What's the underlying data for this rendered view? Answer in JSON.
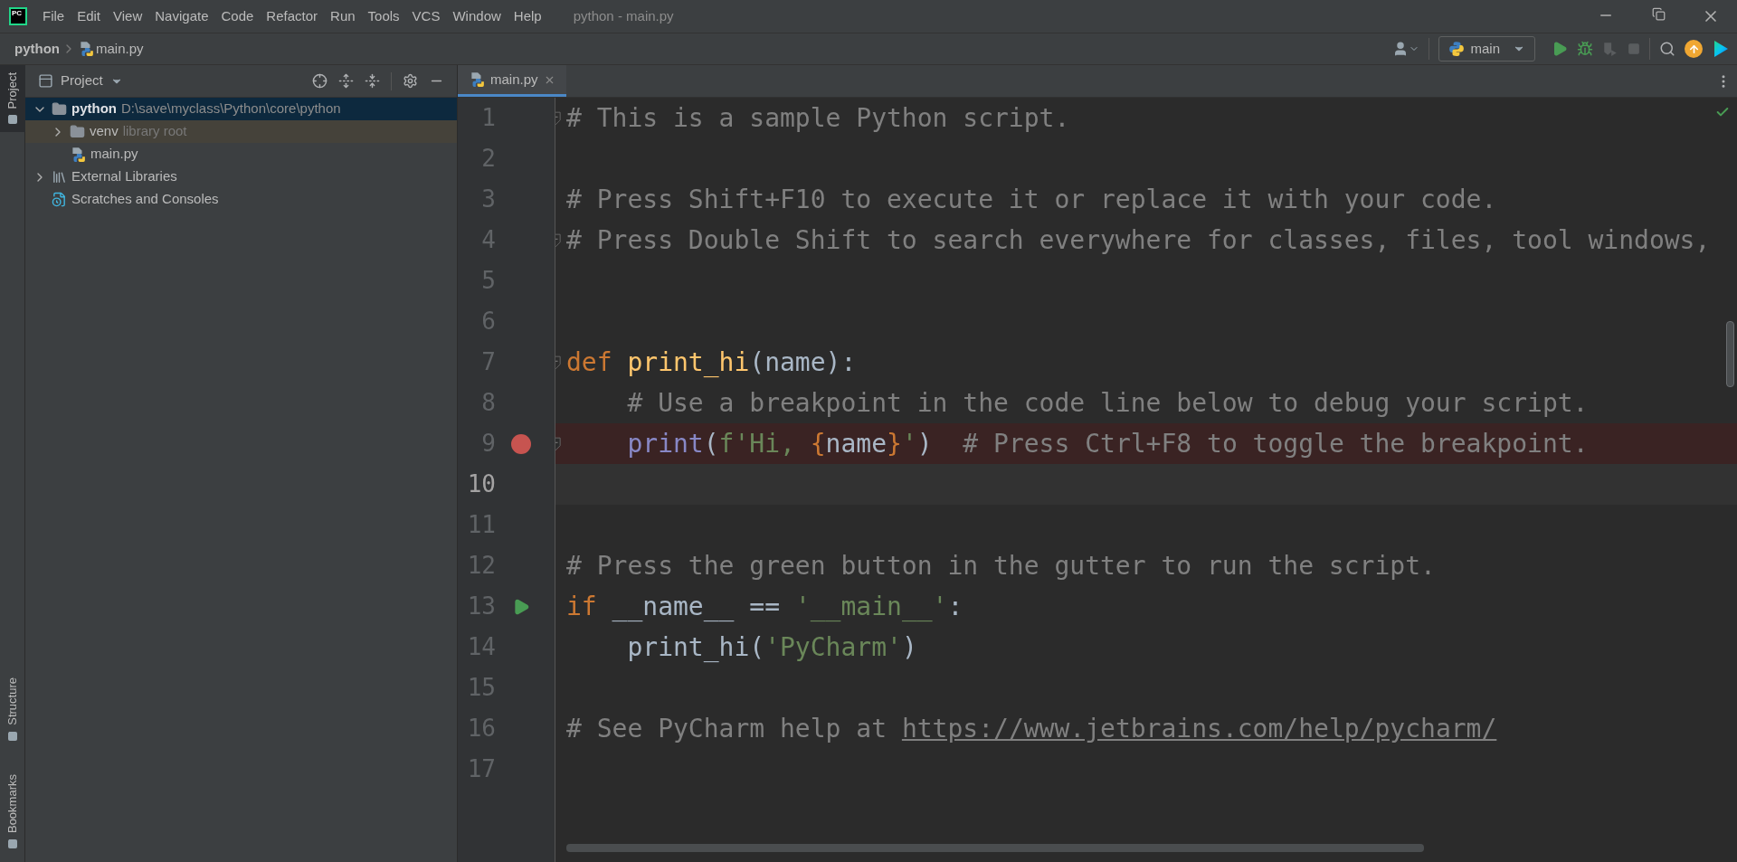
{
  "logo": "PC",
  "menu": [
    "File",
    "Edit",
    "View",
    "Navigate",
    "Code",
    "Refactor",
    "Run",
    "Tools",
    "VCS",
    "Window",
    "Help"
  ],
  "window_title": "python - main.py",
  "breadcrumbs": [
    "python",
    "main.py"
  ],
  "run_config": "main",
  "side_tabs_top": [
    {
      "label": "Project",
      "selected": true
    }
  ],
  "side_tabs_bottom": [
    {
      "label": "Structure",
      "selected": false
    },
    {
      "label": "Bookmarks",
      "selected": false
    }
  ],
  "project_panel": {
    "title": "Project",
    "tree": [
      {
        "name": "python",
        "path": "D:\\save\\myclass\\Python\\core\\python",
        "kind": "folder",
        "expanded": true,
        "selected": true,
        "children": [
          {
            "name": "venv",
            "note": "library root",
            "kind": "library_folder",
            "expanded": false,
            "selected": false
          },
          {
            "name": "main.py",
            "kind": "python_file",
            "selected": false
          }
        ]
      },
      {
        "name": "External Libraries",
        "kind": "libraries",
        "expanded": false,
        "selected": false
      },
      {
        "name": "Scratches and Consoles",
        "kind": "scratches",
        "selected": false
      }
    ]
  },
  "tabs": [
    {
      "label": "main.py",
      "selected": true
    }
  ],
  "code_lines": [
    {
      "number": "1",
      "fold": true,
      "current": false,
      "breakpoint": false,
      "run_marker": false,
      "tokens": [
        {
          "kind": "comment",
          "text": "# This is a sample Python script."
        }
      ]
    },
    {
      "number": "2",
      "fold": false,
      "current": false,
      "breakpoint": false,
      "run_marker": false
    },
    {
      "number": "3",
      "fold": false,
      "current": false,
      "breakpoint": false,
      "run_marker": false,
      "tokens": [
        {
          "kind": "comment",
          "text": "# Press Shift+F10 to execute it or replace it with your code."
        }
      ]
    },
    {
      "number": "4",
      "fold": true,
      "current": false,
      "breakpoint": false,
      "run_marker": false,
      "tokens": [
        {
          "kind": "comment",
          "text": "# Press Double Shift to search everywhere for classes, files, tool windows,"
        }
      ]
    },
    {
      "number": "5",
      "fold": false,
      "current": false,
      "breakpoint": false,
      "run_marker": false
    },
    {
      "number": "6",
      "fold": false,
      "current": false,
      "breakpoint": false,
      "run_marker": false
    },
    {
      "number": "7",
      "fold": true,
      "current": false,
      "breakpoint": false,
      "run_marker": false,
      "tokens": [
        {
          "kind": "keyword",
          "text": "def "
        },
        {
          "kind": "def_name",
          "text": "print_hi"
        },
        {
          "kind": "plain",
          "text": "(name):"
        }
      ]
    },
    {
      "number": "8",
      "fold": false,
      "current": false,
      "breakpoint": false,
      "run_marker": false,
      "tokens": [
        {
          "kind": "comment",
          "text": "    # Use a breakpoint in the code line below to debug your script."
        }
      ]
    },
    {
      "number": "9",
      "fold": true,
      "current": false,
      "breakpoint": true,
      "run_marker": false,
      "tokens": [
        {
          "kind": "builtin",
          "text": "    print"
        },
        {
          "kind": "plain",
          "text": "("
        },
        {
          "kind": "string",
          "text": "f'Hi, "
        },
        {
          "kind": "brace",
          "text": "{"
        },
        {
          "kind": "plain",
          "text": "name"
        },
        {
          "kind": "brace",
          "text": "}"
        },
        {
          "kind": "string",
          "text": "'"
        },
        {
          "kind": "plain",
          "text": ")  "
        },
        {
          "kind": "comment",
          "text": "# Press Ctrl+F8 to toggle the breakpoint."
        }
      ]
    },
    {
      "number": "10",
      "fold": false,
      "current": true,
      "breakpoint": false,
      "run_marker": false
    },
    {
      "number": "11",
      "fold": false,
      "current": false,
      "breakpoint": false,
      "run_marker": false
    },
    {
      "number": "12",
      "fold": false,
      "current": false,
      "breakpoint": false,
      "run_marker": false,
      "tokens": [
        {
          "kind": "comment",
          "text": "# Press the green button in the gutter to run the script."
        }
      ]
    },
    {
      "number": "13",
      "fold": false,
      "current": false,
      "breakpoint": false,
      "run_marker": true,
      "tokens": [
        {
          "kind": "keyword",
          "text": "if"
        },
        {
          "kind": "plain",
          "text": " __name__ == "
        },
        {
          "kind": "string",
          "text": "'__main__'"
        },
        {
          "kind": "plain",
          "text": ":"
        }
      ]
    },
    {
      "number": "14",
      "fold": false,
      "current": false,
      "breakpoint": false,
      "run_marker": false,
      "tokens": [
        {
          "kind": "plain",
          "text": "    print_hi("
        },
        {
          "kind": "string",
          "text": "'PyCharm'"
        },
        {
          "kind": "plain",
          "text": ")"
        }
      ]
    },
    {
      "number": "15",
      "fold": false,
      "current": false,
      "breakpoint": false,
      "run_marker": false
    },
    {
      "number": "16",
      "fold": false,
      "current": false,
      "breakpoint": false,
      "run_marker": false,
      "tokens": [
        {
          "kind": "comment",
          "text": "# See PyCharm help at "
        },
        {
          "kind": "link",
          "text": "https://www.jetbrains.com/help/pycharm/"
        }
      ]
    },
    {
      "number": "17",
      "fold": false,
      "current": false,
      "breakpoint": false,
      "run_marker": false
    }
  ]
}
